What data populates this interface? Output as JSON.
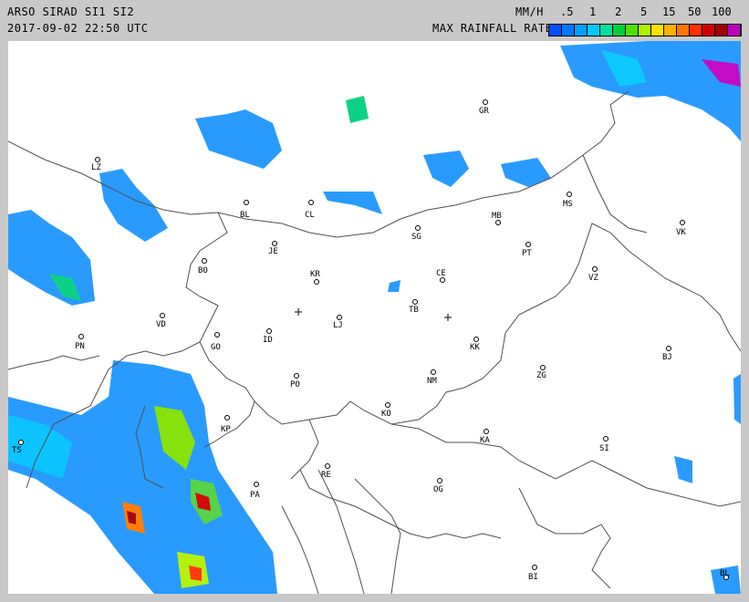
{
  "header": {
    "title": "ARSO SIRAD SI1 SI2",
    "timestamp": "2017-09-02 22:50 UTC",
    "unit": "MM/H",
    "rate_label": "MAX RAINFALL RATE"
  },
  "legend": {
    "ticks": [
      ".5",
      "1",
      "2",
      "5",
      "15",
      "50",
      "100"
    ],
    "colors": [
      "#0050ff",
      "#0078ff",
      "#00a0ff",
      "#00c8ff",
      "#00e0a0",
      "#00d040",
      "#50e000",
      "#b0f000",
      "#ffe000",
      "#ffb000",
      "#ff7800",
      "#ff3000",
      "#d00000",
      "#a00000",
      "#c000c0"
    ]
  },
  "stations": [
    {
      "code": "GR"
    },
    {
      "code": "LZ"
    },
    {
      "code": "BL"
    },
    {
      "code": "CL"
    },
    {
      "code": "MS"
    },
    {
      "code": "MB"
    },
    {
      "code": "VK"
    },
    {
      "code": "SG"
    },
    {
      "code": "JE"
    },
    {
      "code": "PT"
    },
    {
      "code": "BO"
    },
    {
      "code": "KR"
    },
    {
      "code": "CE"
    },
    {
      "code": "VZ"
    },
    {
      "code": "TB"
    },
    {
      "code": "VD"
    },
    {
      "code": "LJ"
    },
    {
      "code": "PN"
    },
    {
      "code": "ID"
    },
    {
      "code": "GO"
    },
    {
      "code": "KK"
    },
    {
      "code": "BJ"
    },
    {
      "code": "PO"
    },
    {
      "code": "NM"
    },
    {
      "code": "ZG"
    },
    {
      "code": "KO"
    },
    {
      "code": "KP"
    },
    {
      "code": "KA"
    },
    {
      "code": "TS"
    },
    {
      "code": "SI"
    },
    {
      "code": "RE"
    },
    {
      "code": "OG"
    },
    {
      "code": "PA"
    },
    {
      "code": "BI"
    },
    {
      "code": "BL"
    }
  ]
}
